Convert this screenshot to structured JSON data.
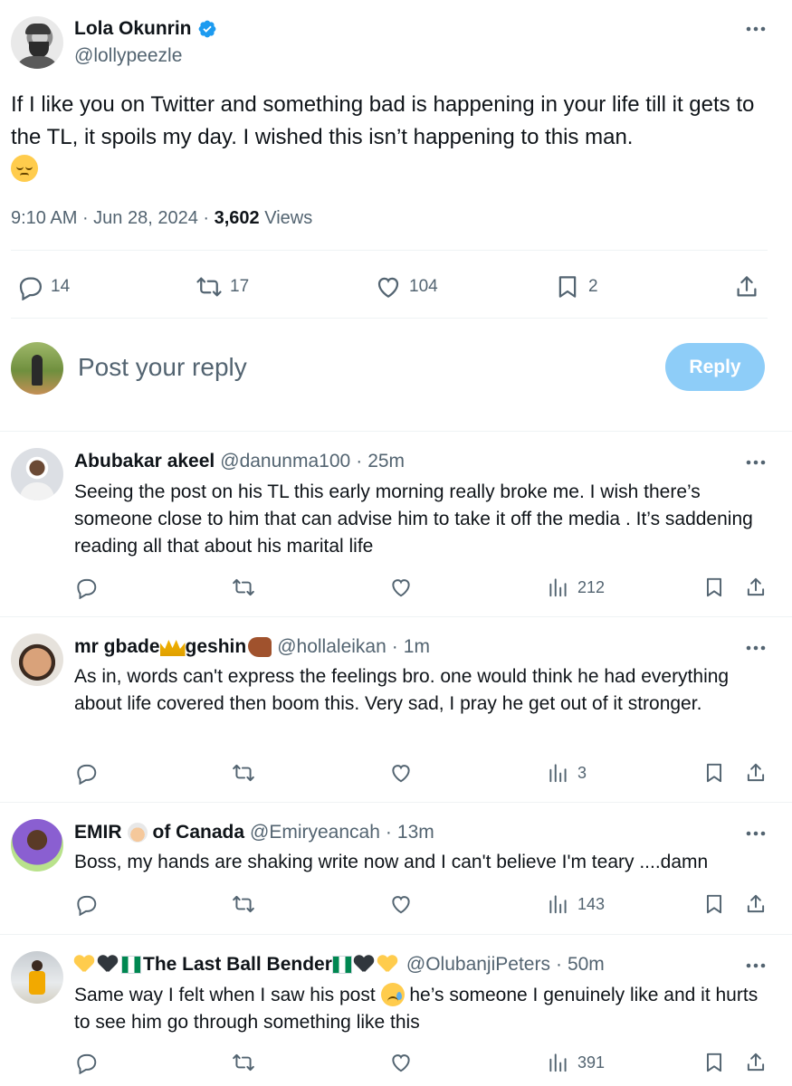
{
  "main_tweet": {
    "author_name": "Lola Okunrin",
    "author_handle": "@lollypeezle",
    "text": "If I like you on Twitter and something bad is happening in your life till it gets to the TL, it spoils my day. I wished this isn’t happening to this man.",
    "time": "9:10 AM",
    "date": "Jun 28, 2024",
    "views_count": "3,602",
    "views_label": "Views",
    "replies": "14",
    "reposts": "17",
    "likes": "104",
    "bookmarks": "2"
  },
  "composer": {
    "placeholder": "Post your reply",
    "button_label": "Reply"
  },
  "replies": [
    {
      "name": "Abubakar akeel",
      "handle": "@danunma100",
      "time": "25m",
      "text": "Seeing the post on his TL this early morning really broke me. I wish there’s someone close to him that can advise him to take it off the media .  It’s saddening reading all that about his marital life",
      "views": "212"
    },
    {
      "name_part1": "mr gbade",
      "name_part2": "geshin",
      "handle": "@hollaleikan",
      "time": "1m",
      "text": "As in, words can't express the feelings bro. one would think he had everything about life covered then boom this. Very sad, I pray he get out of it stronger.",
      "views": "3"
    },
    {
      "name_part1": "EMIR",
      "name_part2": "of Canada",
      "handle": "@Emiryeancah",
      "time": "13m",
      "text": "Boss, my hands are shaking write now and I can't believe I'm teary ....damn",
      "views": "143"
    },
    {
      "name_core": "The Last Ball Bender",
      "handle": "@OlubanjiPeters",
      "time": "50m",
      "text_part1": "Same way I felt when I saw his post",
      "text_part2": "he’s someone I genuinely like and it hurts to see him go through something like this",
      "views": "391"
    }
  ],
  "colors": {
    "accent": "#1d9bf0",
    "reply_button": "#8ecdf8",
    "muted_text": "#536471",
    "divider": "#eff3f4"
  }
}
